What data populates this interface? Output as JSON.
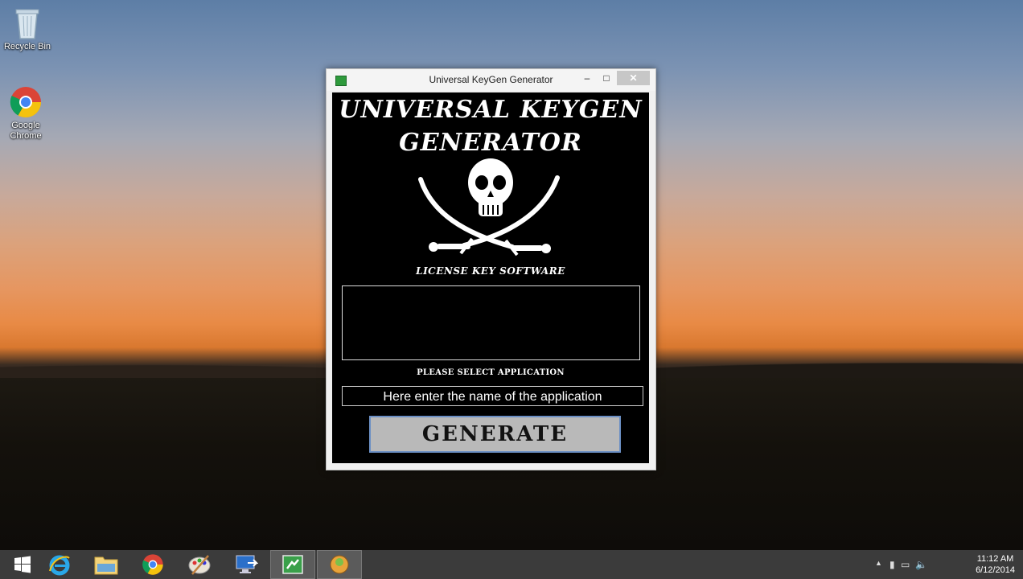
{
  "desktop": {
    "icons": [
      {
        "label": "Recycle Bin"
      },
      {
        "label": "Google Chrome"
      }
    ]
  },
  "window": {
    "title": "Universal KeyGen Generator",
    "minimize": "–",
    "maximize": "□",
    "close": "✕",
    "heading_line1": "UNIVERSAL KEYGEN",
    "heading_line2": "GENERATOR",
    "tagline": "LICENSE KEY SOFTWARE",
    "output_value": "",
    "select_label": "PLEASE SELECT APPLICATION",
    "app_input_value": "Here enter the name of the application",
    "generate_label": "GENERATE"
  },
  "taskbar": {
    "items": [
      "start",
      "internet-explorer",
      "file-explorer",
      "chrome",
      "paint",
      "remote-desktop",
      "keygen",
      "installer"
    ],
    "clock": {
      "time": "11:12 AM",
      "date": "6/12/2014"
    }
  }
}
